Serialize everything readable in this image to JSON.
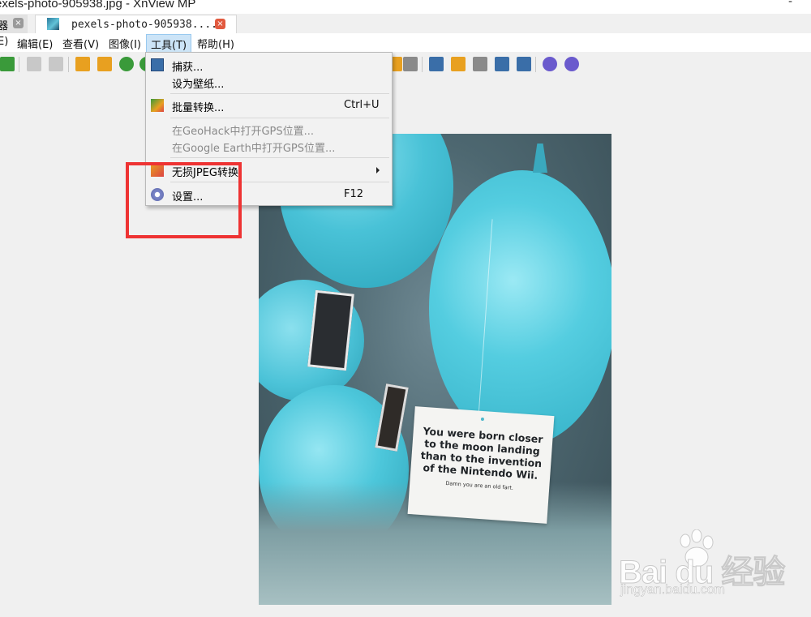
{
  "window": {
    "title": "exels-photo-905938.jpg - XnView MP",
    "control": "‑"
  },
  "tabs": [
    {
      "label": "器",
      "close": "×"
    },
    {
      "label": "pexels-photo-905938....",
      "close": "×"
    }
  ],
  "menubar": {
    "items": [
      "E)",
      "编辑(E)",
      "查看(V)",
      "图像(I)",
      "工具(T)",
      "帮助(H)"
    ],
    "active": "工具(T)"
  },
  "toolbar": {
    "icons": [
      "save-icon",
      "undo-icon",
      "redo-icon",
      "crop-icon",
      "resize-icon",
      "rotate-icon",
      "capture-icon",
      "info-icon",
      "fullscreen-icon",
      "paint-icon",
      "print-icon",
      "scanner-icon",
      "wallpaper-icon",
      "settings-icon",
      "help-icon"
    ],
    "colors": {
      "orange": "#e8a020",
      "blue": "#3a6ea8",
      "green": "#3a9a3a",
      "purple": "#6a5acd",
      "gray": "#8a8a8a"
    }
  },
  "tools_menu": {
    "items": [
      {
        "label": "捕获...",
        "shortcut": "",
        "icon": "capture-icon",
        "disabled": false
      },
      {
        "label": "设为壁纸...",
        "shortcut": "",
        "icon": "",
        "disabled": false
      },
      {
        "label": "批量转换...",
        "shortcut": "Ctrl+U",
        "icon": "batch-convert-icon",
        "disabled": false
      },
      {
        "label": "在GeoHack中打开GPS位置...",
        "shortcut": "",
        "icon": "",
        "disabled": true
      },
      {
        "label": "在Google Earth中打开GPS位置...",
        "shortcut": "",
        "icon": "",
        "disabled": true
      },
      {
        "label": "无损JPEG转换",
        "shortcut": "",
        "icon": "jpeg-transform-icon",
        "disabled": false,
        "submenu": true
      },
      {
        "label": "设置...",
        "shortcut": "F12",
        "icon": "gear-icon",
        "disabled": false
      }
    ]
  },
  "photo": {
    "note_text": "You were born closer to the moon landing than to the invention of the Nintendo Wii.",
    "note_small": "Damn you are an old fart."
  },
  "watermark": {
    "brand": "Bai du 经验",
    "url": "jingyan.baidu.com"
  },
  "highlight_color": "#ee3333"
}
